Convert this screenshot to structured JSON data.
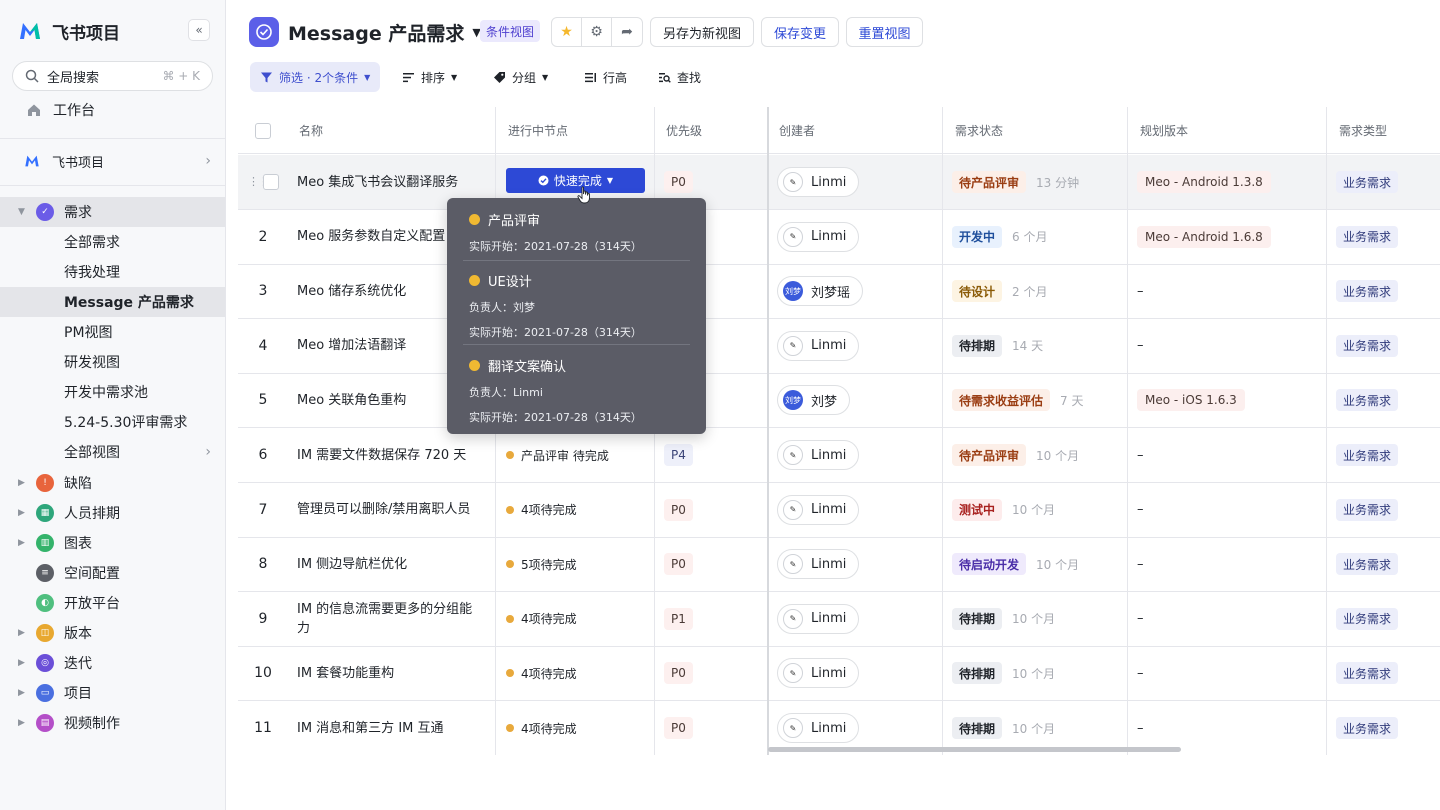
{
  "sidebar": {
    "brand": "飞书项目",
    "collapse": "«",
    "search_placeholder": "全局搜索",
    "search_shortcut": "⌘ + K",
    "workbench": "工作台",
    "space": "飞书项目",
    "modules": [
      {
        "label": "需求",
        "color": "#6b5ce7",
        "expanded": true
      },
      {
        "label": "缺陷",
        "color": "#e8643c"
      },
      {
        "label": "人员排期",
        "color": "#2ea67b"
      },
      {
        "label": "图表",
        "color": "#34b36b"
      },
      {
        "label": "空间配置",
        "color": "#5c5f66"
      },
      {
        "label": "开放平台",
        "color": "#4fbf7f"
      },
      {
        "label": "版本",
        "color": "#e8a830"
      },
      {
        "label": "迭代",
        "color": "#6b4fd8"
      },
      {
        "label": "项目",
        "color": "#4a6fe0"
      },
      {
        "label": "视频制作",
        "color": "#b44fc8"
      }
    ],
    "subviews": [
      "全部需求",
      "待我处理",
      "Message 产品需求",
      "PM视图",
      "研发视图",
      "开发中需求池",
      "5.24-5.30评审需求",
      "全部视图"
    ]
  },
  "header": {
    "title": "Message 产品需求",
    "tag": "条件视图",
    "save_as": "另存为新视图",
    "save": "保存变更",
    "reset": "重置视图"
  },
  "toolbar": {
    "filter": "筛选 · 2个条件",
    "sort": "排序",
    "group": "分组",
    "row_height": "行高",
    "find": "查找"
  },
  "columns": [
    "名称",
    "进行中节点",
    "优先级",
    "创建者",
    "需求状态",
    "规划版本",
    "需求类型"
  ],
  "rows": [
    {
      "idx": "",
      "name": "Meo 集成飞书会议翻译服务",
      "node": "快速完成",
      "prio": "P0",
      "creator": "Linmi",
      "status": "待产品评审",
      "status_time": "13 分钟",
      "version": "Meo - Android 1.3.8",
      "type": "业务需求"
    },
    {
      "idx": "2",
      "name": "Meo 服务参数自定义配置",
      "node": "",
      "prio": "",
      "creator": "Linmi",
      "status": "开发中",
      "status_time": "6 个月",
      "version": "Meo - Android 1.6.8",
      "type": "业务需求"
    },
    {
      "idx": "3",
      "name": "Meo 储存系统优化",
      "node": "",
      "prio": "",
      "creator": "刘梦瑶",
      "status": "待设计",
      "status_time": "2 个月",
      "version": "–",
      "type": "业务需求"
    },
    {
      "idx": "4",
      "name": "Meo 增加法语翻译",
      "node": "",
      "prio": "",
      "creator": "Linmi",
      "status": "待排期",
      "status_time": "14 天",
      "version": "–",
      "type": "业务需求"
    },
    {
      "idx": "5",
      "name": "Meo 关联角色重构",
      "node": "",
      "prio": "",
      "creator": "刘梦",
      "status": "待需求收益评估",
      "status_time": "7 天",
      "version": "Meo - iOS 1.6.3",
      "type": "业务需求"
    },
    {
      "idx": "6",
      "name": "IM 需要文件数据保存 720 天",
      "node": "产品评审 待完成",
      "prio": "P4",
      "creator": "Linmi",
      "status": "待产品评审",
      "status_time": "10 个月",
      "version": "–",
      "type": "业务需求"
    },
    {
      "idx": "7",
      "name": "管理员可以删除/禁用离职人员",
      "node": "4项待完成",
      "prio": "P0",
      "creator": "Linmi",
      "status": "测试中",
      "status_time": "10 个月",
      "version": "–",
      "type": "业务需求"
    },
    {
      "idx": "8",
      "name": "IM 侧边导航栏优化",
      "node": "5项待完成",
      "prio": "P0",
      "creator": "Linmi",
      "status": "待启动开发",
      "status_time": "10 个月",
      "version": "–",
      "type": "业务需求"
    },
    {
      "idx": "9",
      "name": "IM 的信息流需要更多的分组能力",
      "node": "4项待完成",
      "prio": "P1",
      "creator": "Linmi",
      "status": "待排期",
      "status_time": "10 个月",
      "version": "–",
      "type": "业务需求"
    },
    {
      "idx": "10",
      "name": "IM 套餐功能重构",
      "node": "4项待完成",
      "prio": "P0",
      "creator": "Linmi",
      "status": "待排期",
      "status_time": "10 个月",
      "version": "–",
      "type": "业务需求"
    },
    {
      "idx": "11",
      "name": "IM 消息和第三方 IM 互通",
      "node": "4项待完成",
      "prio": "P0",
      "creator": "Linmi",
      "status": "待排期",
      "status_time": "10 个月",
      "version": "–",
      "type": "业务需求"
    }
  ],
  "status_colors": {
    "待产品评审": [
      "#fcefe8",
      "#9a3d12"
    ],
    "开发中": [
      "#e8f1fd",
      "#1f4f9c"
    ],
    "待设计": [
      "#fdf4e3",
      "#8a5a06"
    ],
    "待排期": [
      "#eceef2",
      "#1f2329"
    ],
    "待需求收益评估": [
      "#fcefe8",
      "#9a3d12"
    ],
    "测试中": [
      "#fdecec",
      "#a8211f"
    ],
    "待启动开发": [
      "#efeafc",
      "#4a2ea8"
    ]
  },
  "popover": [
    {
      "title": "产品评审",
      "lines": [
        "实际开始：2021-07-28（314天）"
      ]
    },
    {
      "title": "UE设计",
      "lines": [
        "负责人：刘梦",
        "实际开始：2021-07-28（314天）"
      ]
    },
    {
      "title": "翻译文案确认",
      "lines": [
        "负责人：Linmi",
        "实际开始：2021-07-28（314天）"
      ]
    }
  ]
}
